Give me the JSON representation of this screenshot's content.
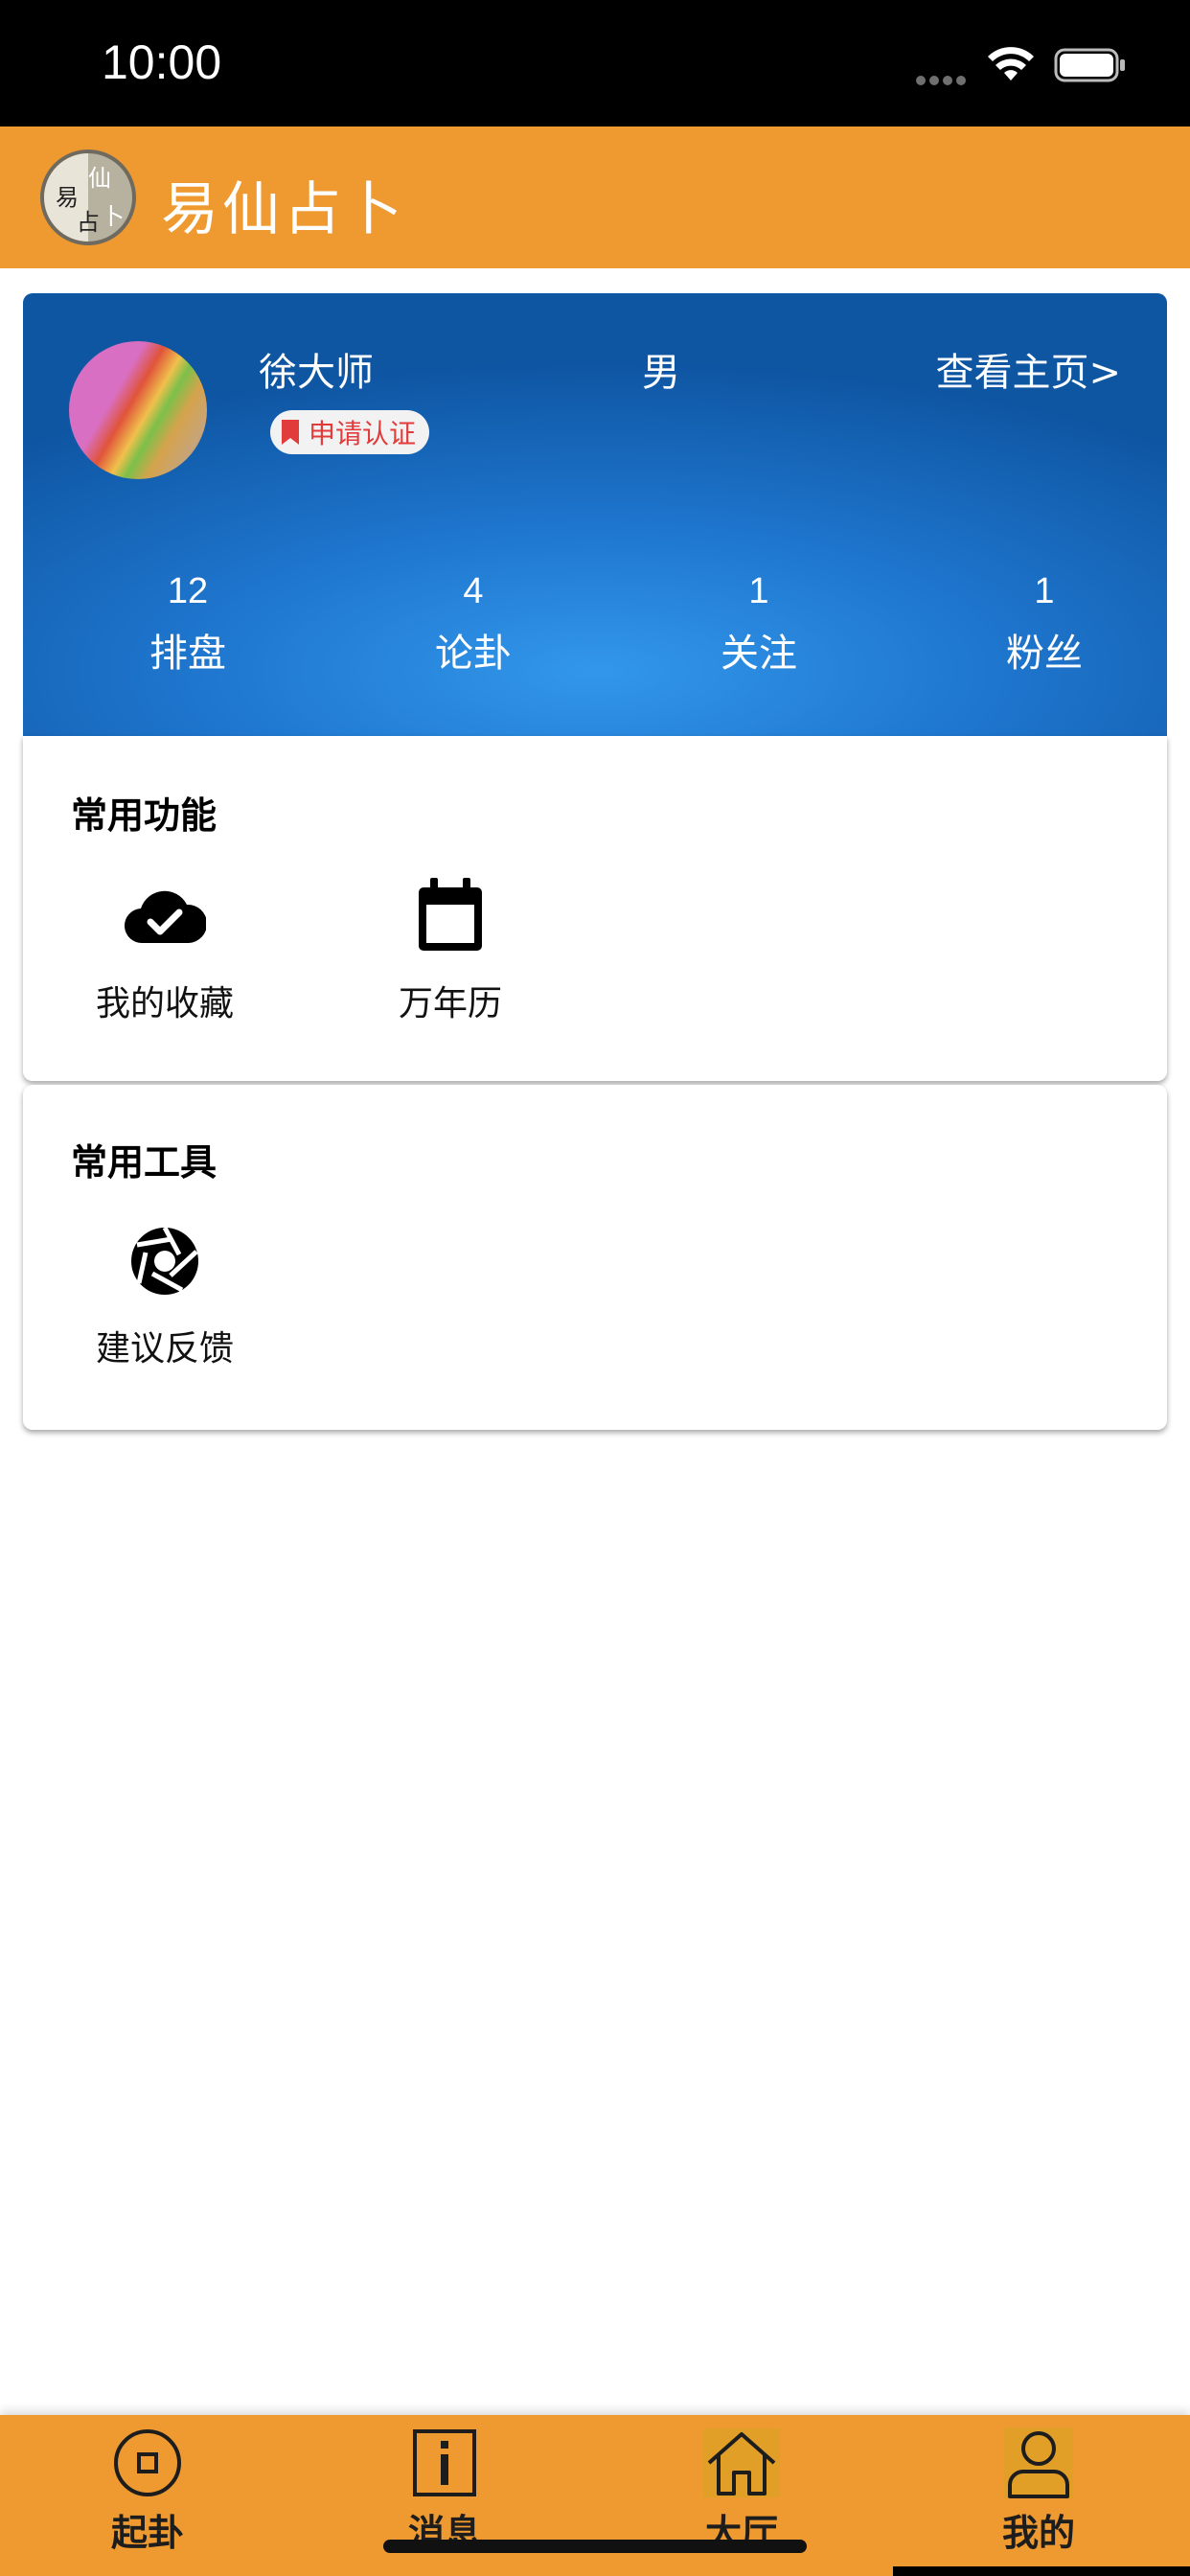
{
  "status_bar": {
    "time": "10:00"
  },
  "header": {
    "title": "易仙占卜",
    "logo_chars": [
      "易",
      "仙",
      "占",
      "卜"
    ]
  },
  "profile": {
    "name": "徐大师",
    "gender": "男",
    "view_home": "查看主页>",
    "cert_label": "申请认证",
    "stats": [
      {
        "value": "12",
        "label": "排盘"
      },
      {
        "value": "4",
        "label": "论卦"
      },
      {
        "value": "1",
        "label": "关注"
      },
      {
        "value": "1",
        "label": "粉丝"
      }
    ]
  },
  "common_functions": {
    "title": "常用功能",
    "items": [
      {
        "label": "我的收藏",
        "icon": "cloud-check-icon"
      },
      {
        "label": "万年历",
        "icon": "calendar-icon"
      }
    ]
  },
  "common_tools": {
    "title": "常用工具",
    "items": [
      {
        "label": "建议反馈",
        "icon": "aperture-icon"
      }
    ]
  },
  "bottom_nav": {
    "items": [
      {
        "label": "起卦",
        "icon": "coin-icon"
      },
      {
        "label": "消息",
        "icon": "info-icon"
      },
      {
        "label": "大厅",
        "icon": "home-icon"
      },
      {
        "label": "我的",
        "icon": "person-icon",
        "active": true
      }
    ]
  },
  "colors": {
    "accent": "#ee9a30",
    "profile_gradient_dark": "#0e55a2",
    "profile_gradient_light": "#3297ea",
    "badge_text": "#e23b3b"
  }
}
